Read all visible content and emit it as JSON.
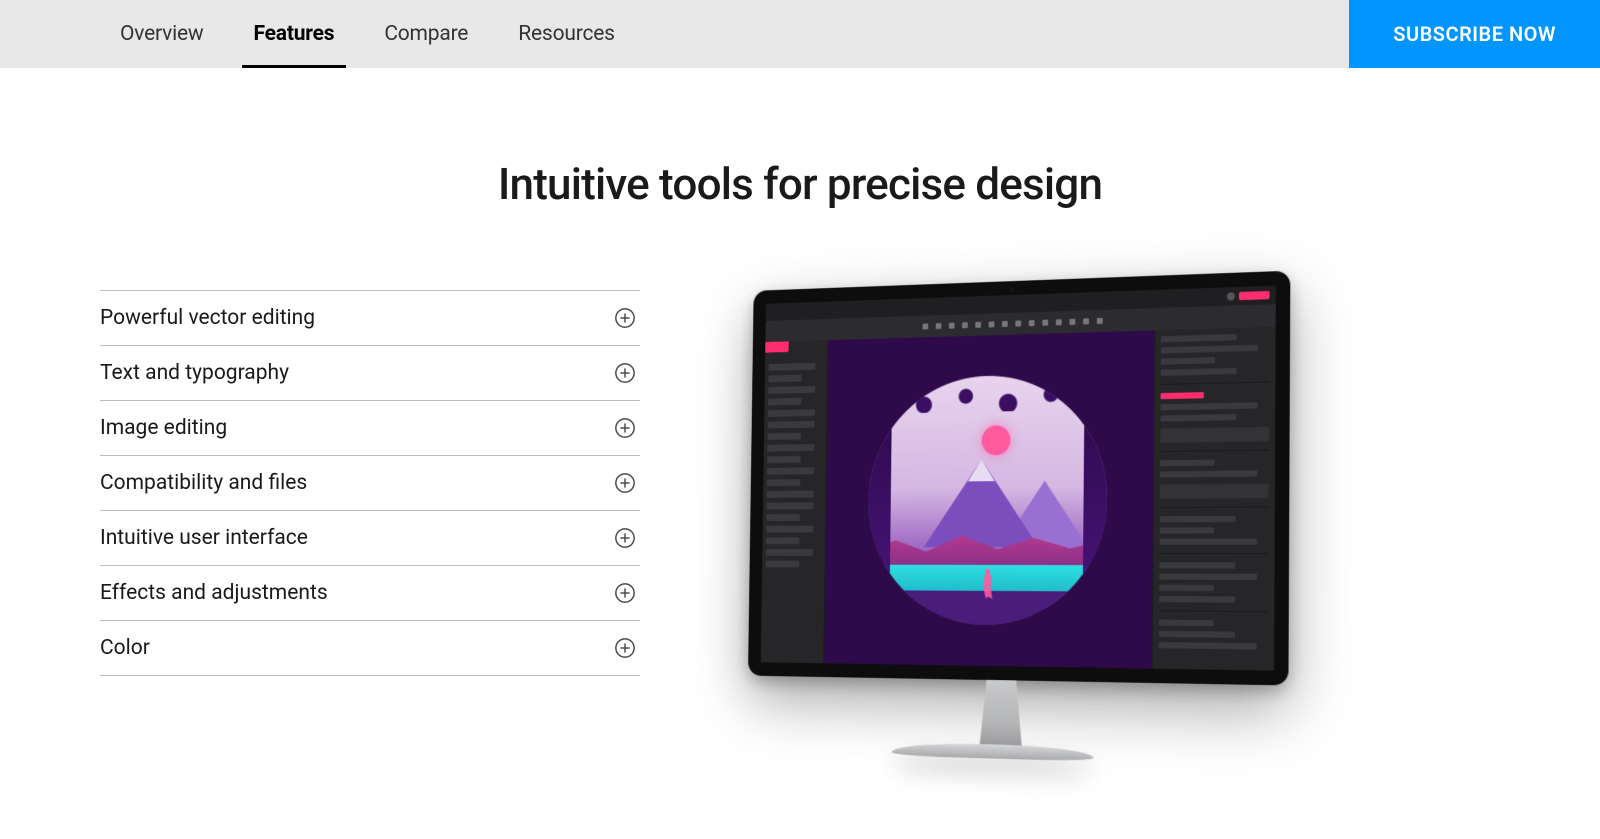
{
  "nav": {
    "tabs": [
      {
        "label": "Overview",
        "active": false
      },
      {
        "label": "Features",
        "active": true
      },
      {
        "label": "Compare",
        "active": false
      },
      {
        "label": "Resources",
        "active": false
      }
    ],
    "cta": "SUBSCRIBE NOW"
  },
  "hero": {
    "title": "Intuitive tools for precise design"
  },
  "accordion": [
    {
      "label": "Powerful vector editing"
    },
    {
      "label": "Text and typography"
    },
    {
      "label": "Image editing"
    },
    {
      "label": "Compatibility and files"
    },
    {
      "label": "Intuitive user interface"
    },
    {
      "label": "Effects and adjustments"
    },
    {
      "label": "Color"
    }
  ]
}
